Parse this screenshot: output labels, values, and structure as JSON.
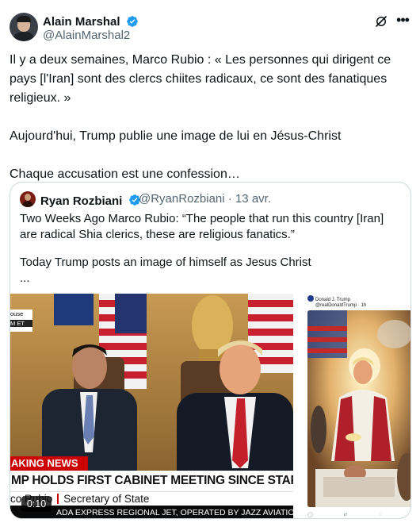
{
  "author": {
    "name": "Alain Marshal",
    "handle": "@AlainMarshal2"
  },
  "tweet": {
    "paragraphs": [
      "Il y a deux semaines, Marco Rubio : « Les personnes qui dirigent ce pays [l'Iran] sont des clercs chiites radicaux, ce sont des fanatiques religieux. »",
      "Aujourd'hui, Trump publie une image de lui en Jésus-Christ",
      "Chaque accusation est une confession…"
    ]
  },
  "quote": {
    "name": "Ryan Rozbiani",
    "handle": "@RyanRozbiani",
    "date": "13 avr.",
    "paragraphs": [
      "Two Weeks Ago Marco Rubio: “The people that run this country [Iran] are radical Shia clerics, these are religious fanatics.”",
      "Today Trump posts an image of himself as Jesus Christ",
      "..."
    ],
    "video": {
      "duration": "0:10",
      "corner_label_top": "ouse",
      "corner_label_bottom": "M ET",
      "breaking_label": "AKING NEWS",
      "headline": "MP HOLDS FIRST CABINET MEETING SINCE START OF IRAN WAR",
      "speaker_name": "co Rubio",
      "speaker_title": "Secretary of State",
      "ticker": "ADA EXPRESS REGIONAL JET, OPERATED BY JAZZ AVIATION, WHI"
    },
    "embedded_post": {
      "author": "Donald J. Trump",
      "meta": "@realDonaldTrump · 1h"
    }
  },
  "colors": {
    "text_primary": "#0f1419",
    "text_secondary": "#536471",
    "verified_blue": "#1d9bf0",
    "border": "#cfd9de",
    "news_red": "#cc0000"
  }
}
